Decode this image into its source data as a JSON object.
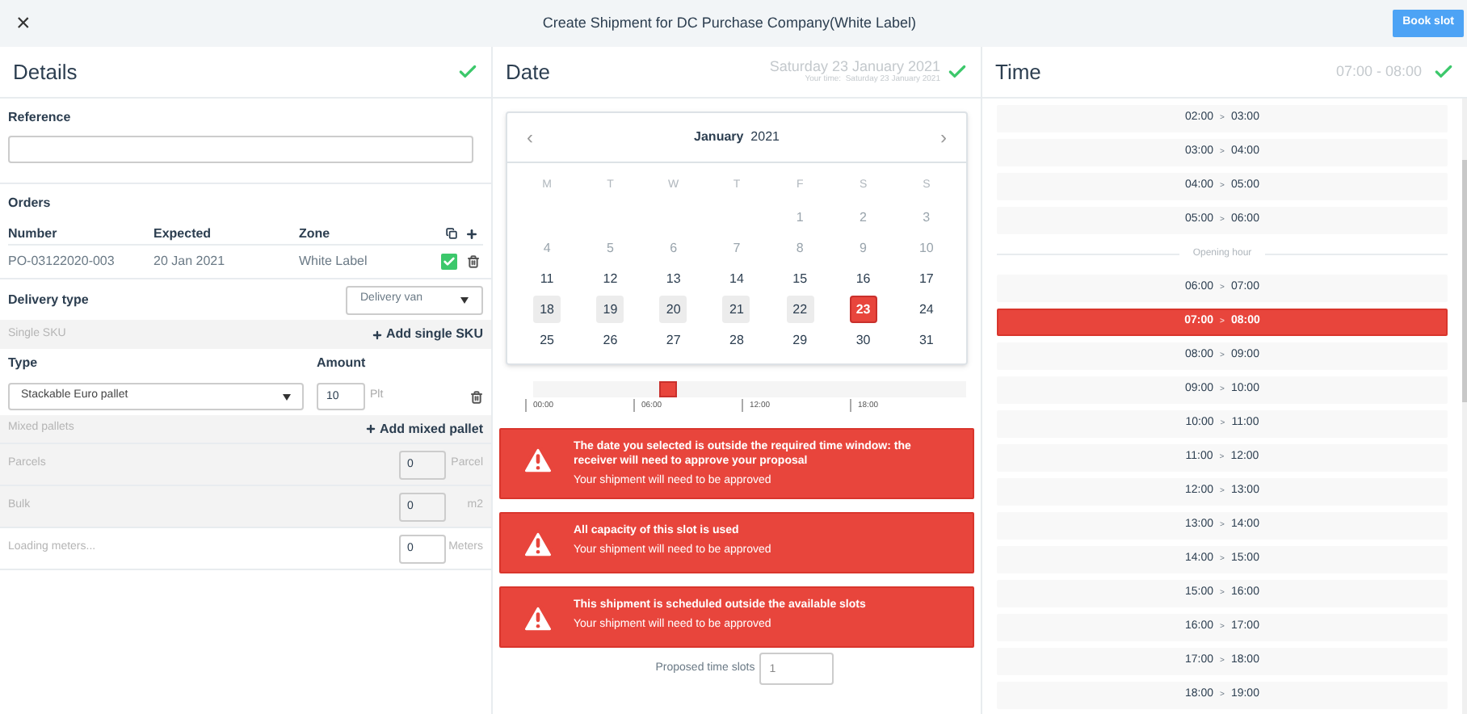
{
  "topbar": {
    "close": "×",
    "title": "Create Shipment for DC Purchase Company(White Label)",
    "book_button": "Book slot"
  },
  "details": {
    "title": "Details",
    "complete": true,
    "reference": {
      "label": "Reference"
    },
    "orders": {
      "title": "Orders",
      "columns": [
        "Number",
        "Expected",
        "Zone"
      ],
      "rows": [
        {
          "number": "PO-03122020-003",
          "expected": "20 Jan 2021",
          "zone": "White Label",
          "checked": true
        }
      ]
    },
    "delivery_type": {
      "label": "Delivery type",
      "value": "Delivery van"
    },
    "single_sku": {
      "label": "Single SKU",
      "add": "Add single SKU",
      "type_label": "Type",
      "amount_label": "Amount",
      "rows": [
        {
          "type": "Stackable Euro pallet",
          "amount": "10",
          "unit": "Plt"
        }
      ]
    },
    "mixed": {
      "label": "Mixed pallets",
      "add": "Add mixed pallet",
      "rows": [
        {
          "label": "Parcels",
          "value": "0",
          "unit": "Parcel",
          "disabled": true
        },
        {
          "label": "Bulk",
          "value": "0",
          "unit": "m2",
          "disabled": true
        },
        {
          "label": "Loading meters...",
          "value": "0",
          "unit": "Meters",
          "disabled": false
        }
      ]
    }
  },
  "date": {
    "title": "Date",
    "complete": true,
    "value": "Saturday 23 January 2021",
    "your_time_label": "Your time:",
    "your_time": "Saturday 23 January 2021",
    "calendar": {
      "month": "January",
      "year": "2021",
      "prev": "‹",
      "next": "›",
      "weekdays": [
        "M",
        "T",
        "W",
        "T",
        "F",
        "S",
        "S"
      ],
      "weeks": [
        [
          {
            "kind": "blank"
          },
          {
            "kind": "blank"
          },
          {
            "kind": "blank"
          },
          {
            "kind": "blank"
          },
          {
            "label": "1",
            "kind": "past",
            "selected": false
          },
          {
            "label": "2",
            "kind": "past",
            "selected": false
          },
          {
            "label": "3",
            "kind": "past",
            "selected": false
          }
        ],
        [
          {
            "label": "4",
            "kind": "past",
            "selected": false
          },
          {
            "label": "5",
            "kind": "past",
            "selected": false
          },
          {
            "label": "6",
            "kind": "past",
            "selected": false
          },
          {
            "label": "7",
            "kind": "past",
            "selected": false
          },
          {
            "label": "8",
            "kind": "past",
            "selected": false
          },
          {
            "label": "9",
            "kind": "past",
            "selected": false
          },
          {
            "label": "10",
            "kind": "past",
            "selected": false
          }
        ],
        [
          {
            "label": "11",
            "kind": "normal",
            "selected": false
          },
          {
            "label": "12",
            "kind": "normal",
            "selected": false
          },
          {
            "label": "13",
            "kind": "normal",
            "selected": false
          },
          {
            "label": "14",
            "kind": "normal",
            "selected": false
          },
          {
            "label": "15",
            "kind": "normal",
            "selected": false
          },
          {
            "label": "16",
            "kind": "normal",
            "selected": false
          },
          {
            "label": "17",
            "kind": "normal",
            "selected": false
          }
        ],
        [
          {
            "label": "18",
            "kind": "marked",
            "selected": false
          },
          {
            "label": "19",
            "kind": "marked",
            "selected": false
          },
          {
            "label": "20",
            "kind": "marked",
            "selected": false
          },
          {
            "label": "21",
            "kind": "marked",
            "selected": false
          },
          {
            "label": "22",
            "kind": "marked",
            "selected": false
          },
          {
            "label": "23",
            "kind": "normal",
            "selected": true
          },
          {
            "label": "24",
            "kind": "normal",
            "selected": false
          }
        ],
        [
          {
            "label": "25",
            "kind": "normal",
            "selected": false
          },
          {
            "label": "26",
            "kind": "normal",
            "selected": false
          },
          {
            "label": "27",
            "kind": "normal",
            "selected": false
          },
          {
            "label": "28",
            "kind": "normal",
            "selected": false
          },
          {
            "label": "29",
            "kind": "normal",
            "selected": false
          },
          {
            "label": "30",
            "kind": "normal",
            "selected": false
          },
          {
            "label": "31",
            "kind": "normal",
            "selected": false
          }
        ]
      ]
    },
    "timeline": {
      "ticks": [
        "00:00",
        "06:00",
        "12:00",
        "18:00"
      ],
      "level": 0.2917
    },
    "alerts": [
      {
        "title": "The date you selected is outside the required time window: the receiver will need to approve your proposal",
        "message": "Your shipment will need to be approved"
      },
      {
        "title": "All capacity of this slot is used",
        "message": "Your shipment will need to be approved"
      },
      {
        "title": "This shipment is scheduled outside the available slots",
        "message": "Your shipment will need to be approved"
      }
    ],
    "proposed": {
      "label": "Proposed time slots",
      "value": "1"
    }
  },
  "time": {
    "title": "Time",
    "complete": true,
    "value": "07:00 - 08:00",
    "slots": [
      {
        "kind": "slot",
        "from": "02:00",
        "sep": ">",
        "to": "03:00",
        "selected": false
      },
      {
        "kind": "slot",
        "from": "03:00",
        "sep": ">",
        "to": "04:00",
        "selected": false
      },
      {
        "kind": "slot",
        "from": "04:00",
        "sep": ">",
        "to": "05:00",
        "selected": false
      },
      {
        "kind": "slot",
        "from": "05:00",
        "sep": ">",
        "to": "06:00",
        "selected": false
      },
      {
        "kind": "divider",
        "label": "Opening hour"
      },
      {
        "kind": "slot",
        "from": "06:00",
        "sep": ">",
        "to": "07:00",
        "selected": false
      },
      {
        "kind": "slot",
        "from": "07:00",
        "sep": ">",
        "to": "08:00",
        "selected": true
      },
      {
        "kind": "slot",
        "from": "08:00",
        "sep": ">",
        "to": "09:00",
        "selected": false
      },
      {
        "kind": "slot",
        "from": "09:00",
        "sep": ">",
        "to": "10:00",
        "selected": false
      },
      {
        "kind": "slot",
        "from": "10:00",
        "sep": ">",
        "to": "11:00",
        "selected": false
      },
      {
        "kind": "slot",
        "from": "11:00",
        "sep": ">",
        "to": "12:00",
        "selected": false
      },
      {
        "kind": "slot",
        "from": "12:00",
        "sep": ">",
        "to": "13:00",
        "selected": false
      },
      {
        "kind": "slot",
        "from": "13:00",
        "sep": ">",
        "to": "14:00",
        "selected": false
      },
      {
        "kind": "slot",
        "from": "14:00",
        "sep": ">",
        "to": "15:00",
        "selected": false
      },
      {
        "kind": "slot",
        "from": "15:00",
        "sep": ">",
        "to": "16:00",
        "selected": false
      },
      {
        "kind": "slot",
        "from": "16:00",
        "sep": ">",
        "to": "17:00",
        "selected": false
      },
      {
        "kind": "slot",
        "from": "17:00",
        "sep": ">",
        "to": "18:00",
        "selected": false
      },
      {
        "kind": "slot",
        "from": "18:00",
        "sep": ">",
        "to": "19:00",
        "selected": false
      }
    ]
  }
}
